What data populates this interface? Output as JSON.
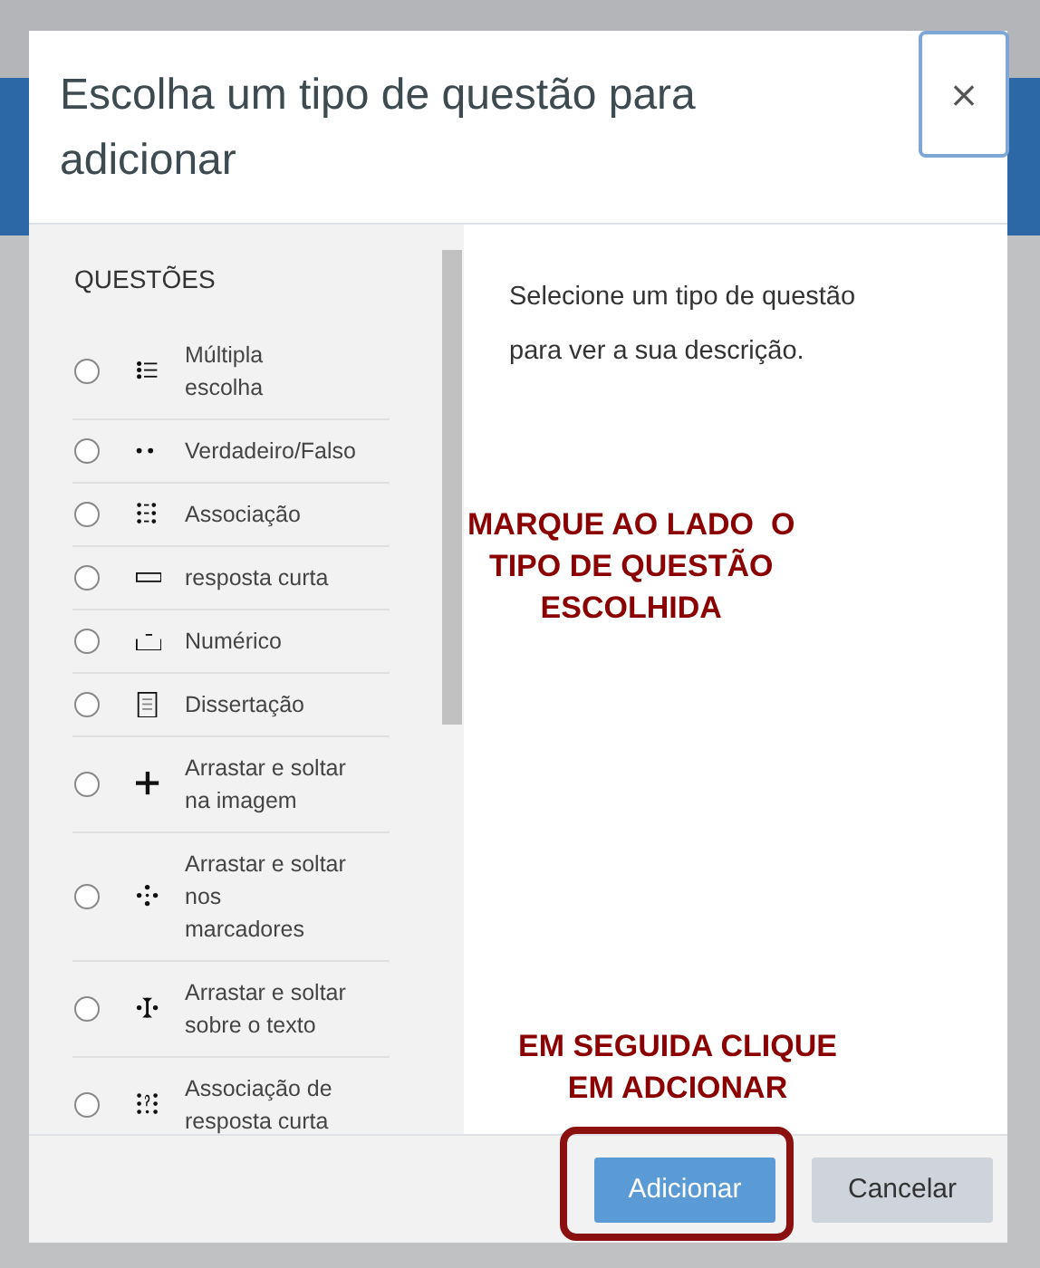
{
  "dialog": {
    "title": "Escolha um tipo de questão para adicionar",
    "close_button": "×",
    "list_heading": "QUESTÕES",
    "question_types": [
      {
        "label": "Múltipla\nescolha",
        "selected": false
      },
      {
        "label": "Verdadeiro/Falso",
        "selected": false
      },
      {
        "label": "Associação",
        "selected": false
      },
      {
        "label": "resposta curta",
        "selected": false
      },
      {
        "label": "Numérico",
        "selected": false
      },
      {
        "label": "Dissertação",
        "selected": false
      },
      {
        "label": "Arrastar e soltar\nna imagem",
        "selected": false
      },
      {
        "label": "Arrastar e soltar\nnos\nmarcadores",
        "selected": false
      },
      {
        "label": "Arrastar e soltar\nsobre o texto",
        "selected": false
      },
      {
        "label": "Associação de\nresposta curta",
        "selected": false
      }
    ],
    "description": "Selecione um tipo de questão para ver a sua descrição.",
    "buttons": [
      {
        "label": "Adicionar",
        "kind": "primary"
      },
      {
        "label": "Cancelar",
        "kind": "secondary"
      }
    ]
  },
  "annotations": [
    {
      "kind": "note",
      "text": "MARQUE AO LADO  O\nTIPO DE QUESTÃO\nESCOLHIDA"
    },
    {
      "kind": "note",
      "text": "EM SEGUIDA CLIQUE\nEM ADCIONAR"
    },
    {
      "kind": "highlight"
    }
  ]
}
